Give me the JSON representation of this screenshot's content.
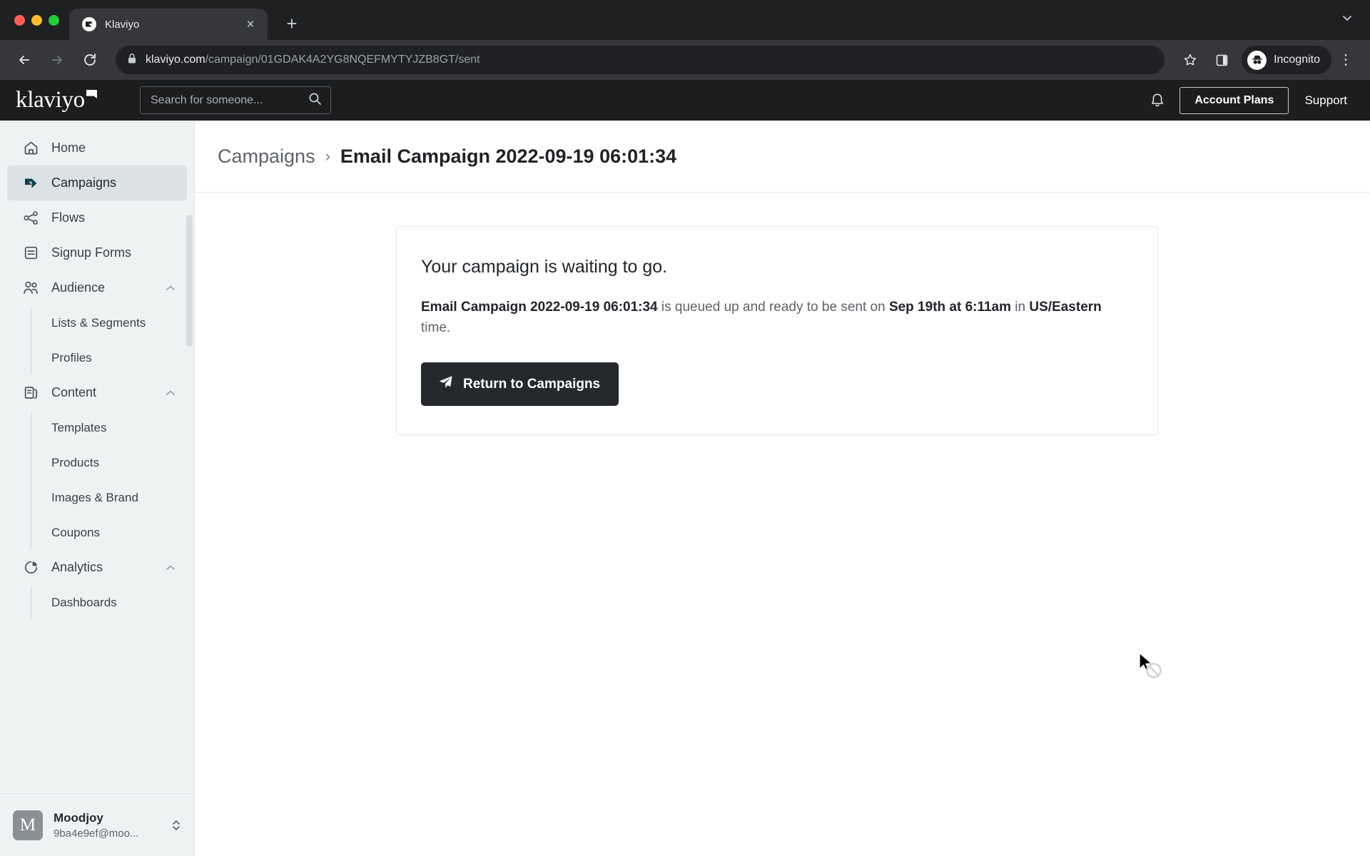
{
  "browser": {
    "tab": {
      "title": "Klaviyo",
      "favicon": "klaviyo-favicon",
      "close": "×"
    },
    "new_tab": "+",
    "tabstrip_caret": "⌄",
    "nav": {
      "back": "←",
      "forward": "→",
      "reload": "↻"
    },
    "omnibox": {
      "lock_icon": "lock-icon",
      "domain": "klaviyo.com",
      "path": "/campaign/01GDAK4A2YG8NQEFMYTYJZB8GT/sent"
    },
    "bookmark_icon": "star-icon",
    "sidepanel_icon": "side-panel-icon",
    "profile": {
      "label": "Incognito",
      "icon": "incognito-icon"
    },
    "menu_icon": "⋮"
  },
  "header": {
    "logo": "klaviyo",
    "search": {
      "placeholder": "Search for someone...",
      "value": "",
      "icon": "search-icon"
    },
    "notifications_icon": "bell-icon",
    "account_plans": "Account Plans",
    "support": "Support"
  },
  "sidebar": {
    "items": [
      {
        "label": "Home",
        "icon": "home-icon",
        "active": false,
        "expandable": false
      },
      {
        "label": "Campaigns",
        "icon": "campaigns-icon",
        "active": true,
        "expandable": false
      },
      {
        "label": "Flows",
        "icon": "flows-icon",
        "active": false,
        "expandable": false
      },
      {
        "label": "Signup Forms",
        "icon": "signup-forms-icon",
        "active": false,
        "expandable": false
      },
      {
        "label": "Audience",
        "icon": "audience-icon",
        "active": false,
        "expandable": true,
        "caret": "chevron-up-icon"
      },
      {
        "label": "Content",
        "icon": "content-icon",
        "active": false,
        "expandable": true,
        "caret": "chevron-up-icon"
      },
      {
        "label": "Analytics",
        "icon": "analytics-icon",
        "active": false,
        "expandable": true,
        "caret": "chevron-up-icon"
      }
    ],
    "audience_children": [
      "Lists & Segments",
      "Profiles"
    ],
    "content_children": [
      "Templates",
      "Products",
      "Images & Brand",
      "Coupons"
    ],
    "analytics_children": [
      "Dashboards"
    ],
    "account": {
      "avatar_initial": "M",
      "name": "Moodjoy",
      "email": "9ba4e9ef@moo...",
      "switcher_icon": "chevron-up-down-icon"
    }
  },
  "breadcrumb": {
    "parent": "Campaigns",
    "separator": "›",
    "current": "Email Campaign 2022-09-19 06:01:34"
  },
  "card": {
    "title": "Your campaign is waiting to go.",
    "desc_campaign_name": "Email Campaign 2022-09-19 06:01:34",
    "desc_mid": " is queued up and ready to be sent on ",
    "desc_date": "Sep 19th at 6:11am",
    "desc_in": " in ",
    "desc_timezone": "US/Eastern",
    "desc_end": " time.",
    "button": {
      "label": "Return to Campaigns",
      "icon": "paper-plane-icon"
    }
  },
  "cursor": {
    "type": "not-allowed-cursor"
  },
  "colors": {
    "chrome_dark": "#35373a",
    "chrome_tabstrip": "#1f2022",
    "app_header": "#1c1d1f",
    "sidebar_bg": "#eef2f3",
    "sidebar_active": "#dbe1e4",
    "campaigns_icon": "#11414d",
    "button_dark": "#25282c",
    "text_primary": "#22252a",
    "text_muted": "#5f6368"
  }
}
